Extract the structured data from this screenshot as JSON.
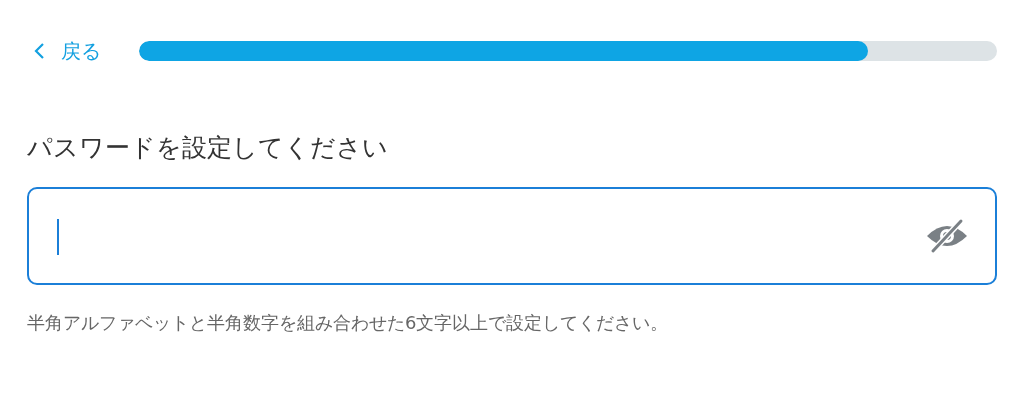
{
  "header": {
    "back_label": "戻る",
    "progress": {
      "level": 0.85
    }
  },
  "title": "パスワードを設定してください",
  "password_field": {
    "focused": true,
    "password_visible": false
  },
  "hint": "半角アルファベットと半角数字を組み合わせた6文字以上で設定してください。"
}
